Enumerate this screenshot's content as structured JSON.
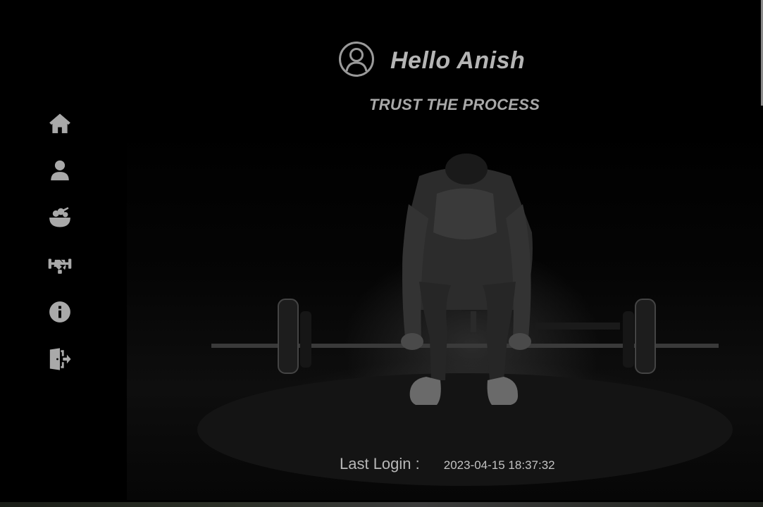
{
  "header": {
    "greeting": "Hello Anish",
    "tagline": "TRUST THE PROCESS"
  },
  "sidebar": {
    "items": [
      {
        "name": "home",
        "icon": "home-icon"
      },
      {
        "name": "profile",
        "icon": "user-icon"
      },
      {
        "name": "diet",
        "icon": "salad-bowl-icon"
      },
      {
        "name": "workout",
        "icon": "dumbbell-handshake-icon"
      },
      {
        "name": "about",
        "icon": "info-icon"
      },
      {
        "name": "logout",
        "icon": "logout-icon"
      }
    ]
  },
  "footer": {
    "last_login_label": "Last Login :",
    "last_login_value": "2023-04-15 18:37:32"
  },
  "colors": {
    "background": "#000000",
    "text": "#b5b5b5",
    "icon": "#a9a9a9"
  }
}
